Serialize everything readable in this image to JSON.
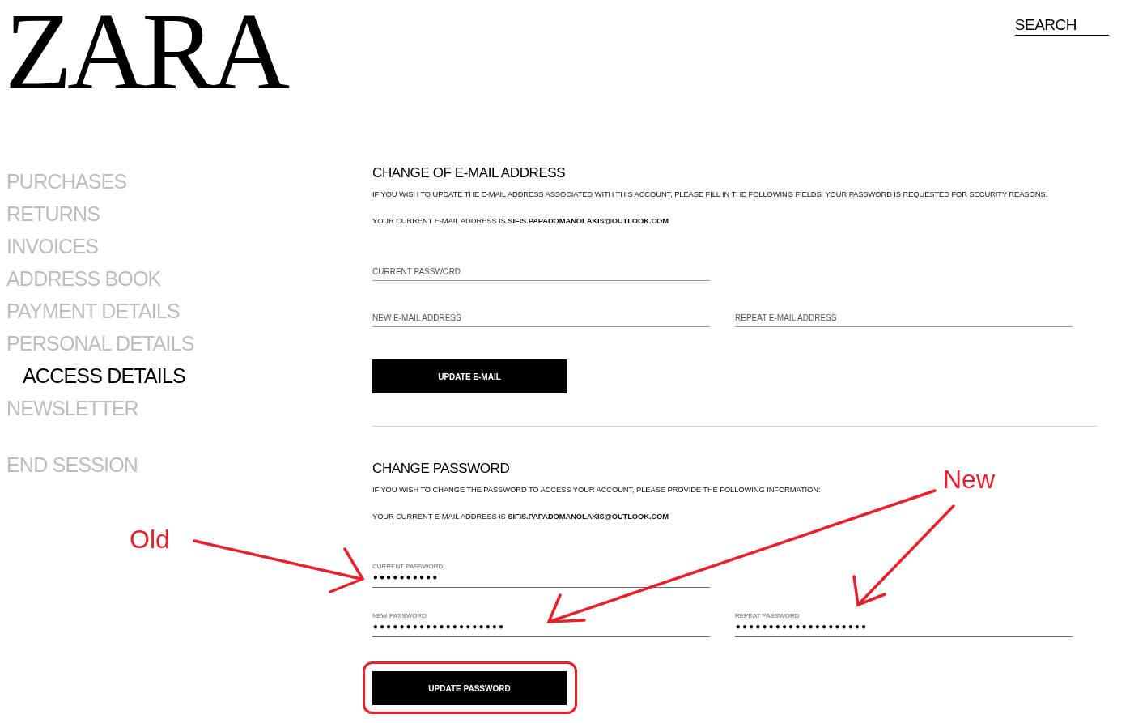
{
  "logo": "ZARA",
  "header": {
    "search": "SEARCH"
  },
  "sidebar": {
    "items": [
      {
        "label": "PURCHASES",
        "selected": false
      },
      {
        "label": "RETURNS",
        "selected": false
      },
      {
        "label": "INVOICES",
        "selected": false
      },
      {
        "label": "ADDRESS BOOK",
        "selected": false
      },
      {
        "label": "PAYMENT DETAILS",
        "selected": false
      },
      {
        "label": "PERSONAL DETAILS",
        "selected": false
      },
      {
        "label": "ACCESS DETAILS",
        "selected": true
      },
      {
        "label": "NEWSLETTER",
        "selected": false
      }
    ],
    "end_session": "END SESSION"
  },
  "email_section": {
    "title": "CHANGE OF E-MAIL ADDRESS",
    "description": "IF YOU WISH TO UPDATE THE E-MAIL ADDRESS ASSOCIATED WITH THIS ACCOUNT, PLEASE FILL IN THE FOLLOWING FIELDS. YOUR PASSWORD IS REQUESTED FOR SECURITY REASONS.",
    "current_email": "YOUR CURRENT E-MAIL ADDRESS IS **SIFIS.PAPADOMANOLAKIS@OUTLOOK.COM**",
    "rows": [
      [
        {
          "placeholder": "CURRENT PASSWORD"
        }
      ],
      [
        {
          "placeholder": "NEW E-MAIL ADDRESS"
        },
        {
          "placeholder": "REPEAT E-MAIL ADDRESS"
        }
      ]
    ],
    "button": "UPDATE E-MAIL"
  },
  "password_section": {
    "title": "CHANGE PASSWORD",
    "description": "IF YOU WISH TO CHANGE THE PASSWORD TO ACCESS YOUR ACCOUNT, PLEASE PROVIDE THE FOLLOWING INFORMATION:",
    "current_email": "YOUR CURRENT E-MAIL ADDRESS IS **SIFIS.PAPADOMANOLAKIS@OUTLOOK.COM**",
    "rows": [
      [
        {
          "label": "CURRENT PASSWORD",
          "value": "••••••••••"
        }
      ],
      [
        {
          "label": "NEW PASSWORD",
          "value": "••••••••••••••••••••"
        },
        {
          "label": "REPEAT PASSWORD",
          "value": "••••••••••••••••••••"
        }
      ]
    ],
    "button": "UPDATE PASSWORD"
  },
  "annotations": [
    {
      "text": "Old"
    },
    {
      "text": "New"
    }
  ]
}
